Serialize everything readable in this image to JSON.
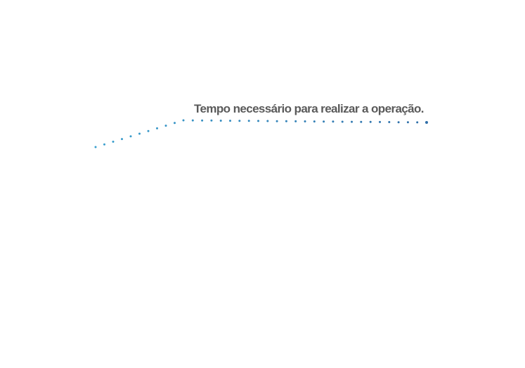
{
  "annotation": {
    "label": "Tempo necessário para realizar a operação.",
    "text_color": "#5a5a5a",
    "leader_color_start": "#3aa0cf",
    "leader_color_end": "#2f6ea8"
  }
}
